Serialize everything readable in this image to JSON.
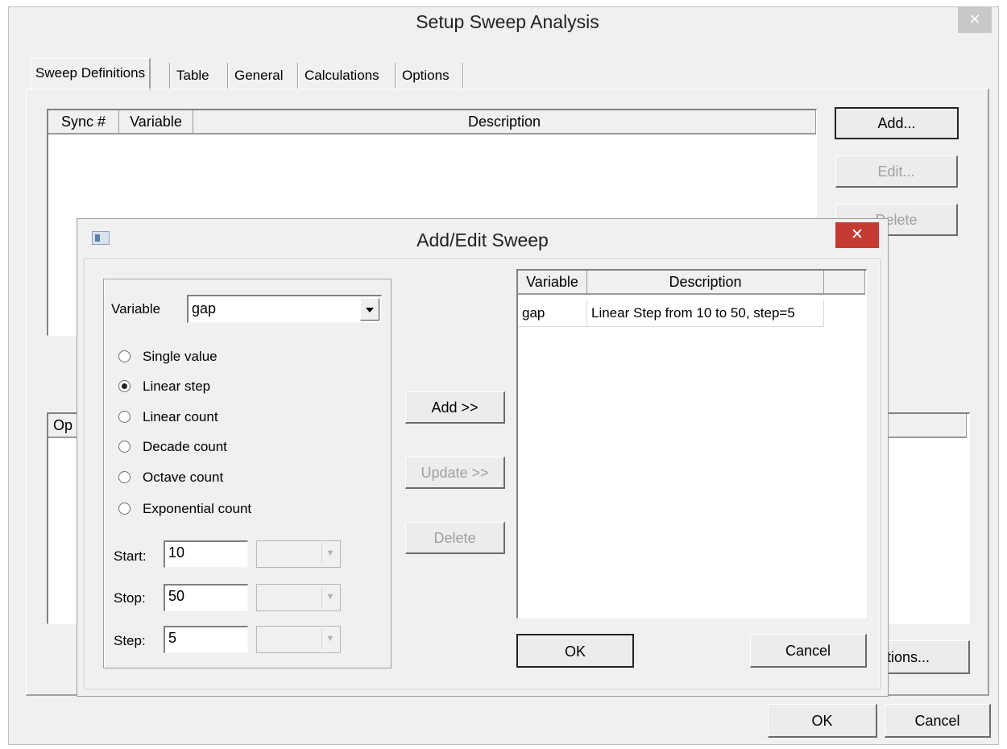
{
  "outer_window": {
    "title": "Setup Sweep Analysis",
    "close_symbol": "✕",
    "tabs": [
      "Sweep Definitions",
      "Table",
      "General",
      "Calculations",
      "Options"
    ],
    "sweep_table": {
      "columns": [
        "Sync #",
        "Variable",
        "Description"
      ]
    },
    "side_buttons": {
      "add": "Add...",
      "edit": "Edit...",
      "delete": "Delete"
    },
    "lower_table": {
      "columns": [
        "Op"
      ]
    },
    "options_button": "Options...",
    "ok": "OK",
    "cancel": "Cancel"
  },
  "dialog": {
    "title": "Add/Edit Sweep",
    "close_symbol": "✕",
    "variable_label": "Variable",
    "variable_value": "gap",
    "radios": [
      {
        "label": "Single value",
        "selected": false
      },
      {
        "label": "Linear step",
        "selected": true
      },
      {
        "label": "Linear count",
        "selected": false
      },
      {
        "label": "Decade count",
        "selected": false
      },
      {
        "label": "Octave count",
        "selected": false
      },
      {
        "label": "Exponential count",
        "selected": false
      }
    ],
    "start_label": "Start:",
    "start_value": "10",
    "stop_label": "Stop:",
    "stop_value": "50",
    "step_label": "Step:",
    "step_value": "5",
    "add_button": "Add >>",
    "update_button": "Update >>",
    "delete_button": "Delete",
    "table": {
      "columns": [
        "Variable",
        "Description",
        ""
      ],
      "rows": [
        {
          "variable": "gap",
          "description": "Linear Step from 10 to 50, step=5"
        }
      ]
    },
    "ok": "OK",
    "cancel": "Cancel"
  }
}
